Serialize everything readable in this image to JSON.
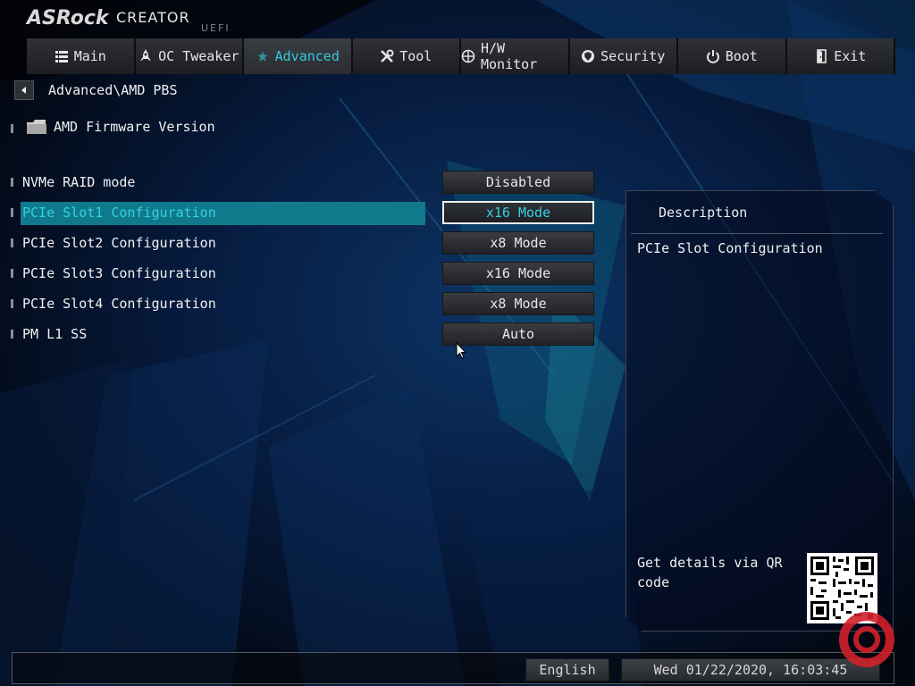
{
  "header": {
    "brand": "ASRock",
    "product": "CREATOR",
    "uefi": "UEFI"
  },
  "tabs": [
    {
      "label": "Main",
      "icon": "list-icon"
    },
    {
      "label": "OC Tweaker",
      "icon": "rocket-icon"
    },
    {
      "label": "Advanced",
      "icon": "star-icon",
      "active": true
    },
    {
      "label": "Tool",
      "icon": "tools-icon"
    },
    {
      "label": "H/W Monitor",
      "icon": "monitor-icon"
    },
    {
      "label": "Security",
      "icon": "shield-icon"
    },
    {
      "label": "Boot",
      "icon": "power-icon"
    },
    {
      "label": "Exit",
      "icon": "exit-icon"
    }
  ],
  "breadcrumb": "Advanced\\AMD PBS",
  "firmware_item": "AMD Firmware Version",
  "settings": [
    {
      "label": "NVMe RAID mode",
      "value": "Disabled"
    },
    {
      "label": "PCIe Slot1 Configuration",
      "value": "x16 Mode",
      "selected": true
    },
    {
      "label": "PCIe Slot2 Configuration",
      "value": "x8 Mode"
    },
    {
      "label": "PCIe Slot3 Configuration",
      "value": "x16 Mode"
    },
    {
      "label": "PCIe Slot4 Configuration",
      "value": "x8 Mode"
    },
    {
      "label": "PM L1 SS",
      "value": "Auto"
    }
  ],
  "description": {
    "title": "Description",
    "text": "PCIe Slot Configuration",
    "qr_text": "Get details via QR code"
  },
  "footer": {
    "language": "English",
    "datetime": "Wed 01/22/2020, 16:03:45"
  },
  "colors": {
    "accent": "#33c9de",
    "selection_bar": "#107a8c",
    "background": "#040a18"
  }
}
